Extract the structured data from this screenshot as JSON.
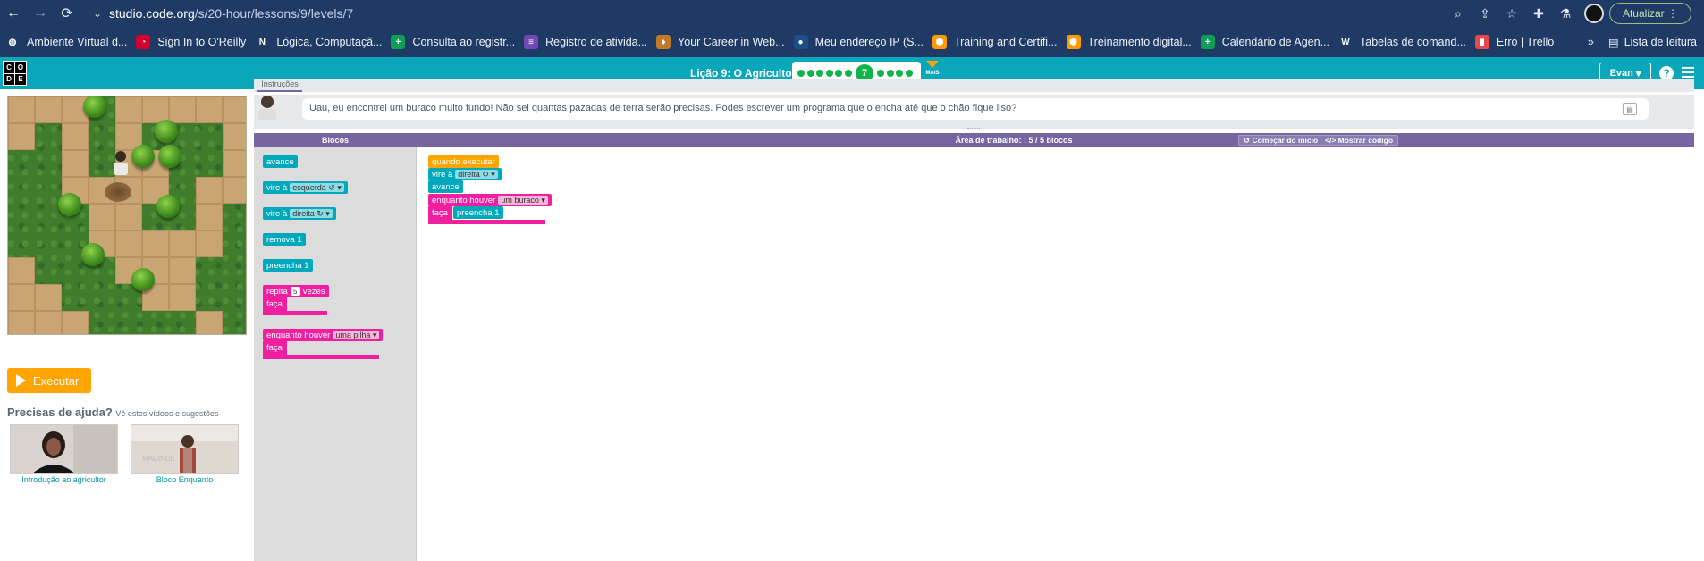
{
  "browser": {
    "url_host": "studio.code.org",
    "url_path": "/s/20-hour/lessons/9/levels/7",
    "update_label": "Atualizar",
    "bookmarks": [
      {
        "label": "Ambiente Virtual d...",
        "icon": "globe-icon",
        "color": "#ffffff"
      },
      {
        "label": "Sign In to O'Reilly",
        "icon": "oreilly-icon",
        "color": "#d3002d"
      },
      {
        "label": "Lógica, Computaçã...",
        "icon": "notion-icon",
        "color": "#ffffff"
      },
      {
        "label": "Consulta ao registr...",
        "icon": "sheets-icon",
        "color": "#0f9d58"
      },
      {
        "label": "Registro de ativida...",
        "icon": "forms-icon",
        "color": "#7248b9"
      },
      {
        "label": "Your Career in Web...",
        "icon": "badge-icon",
        "color": "#c0792a"
      },
      {
        "label": "Meu endereço IP (S...",
        "icon": "ip-icon",
        "color": "#1b4f8a"
      },
      {
        "label": "Training and Certifi...",
        "icon": "aws-icon",
        "color": "#ff9900"
      },
      {
        "label": "Treinamento digital...",
        "icon": "aws-icon",
        "color": "#ff9900"
      },
      {
        "label": "Calendário de Agen...",
        "icon": "sheets-icon",
        "color": "#0f9d58"
      },
      {
        "label": "Tabelas de comand...",
        "icon": "wordpress-icon",
        "color": "#ffffff"
      },
      {
        "label": "Erro | Trello",
        "icon": "trello-icon",
        "color": "#e5484d"
      }
    ],
    "reading_list_label": "Lista de leitura"
  },
  "header": {
    "lesson_title": "Lição 9: O Agricultor",
    "current_level": "7",
    "dots_before": 6,
    "dots_after": 4,
    "more_label": "MAIS",
    "user_label": "Evan"
  },
  "left": {
    "run_label": "Executar",
    "help_title": "Precisas de ajuda?",
    "help_sub": "Vê estes vídeos e sugestões",
    "videos": [
      {
        "caption": "Introdução ao agricultor"
      },
      {
        "caption": "Bloco Enquanto"
      }
    ]
  },
  "instructions": {
    "tab_label": "Instruções",
    "text": "Uau, eu encontrei um buraco muito fundo! Não sei quantas pazadas de terra serão precisas. Podes escrever um programa que o encha até que o chão fique liso?"
  },
  "workspace": {
    "blocks_title": "Blocos",
    "area_title": "Área de trabalho: : 5 / 5 blocos",
    "restart_label": "Começar do início",
    "show_code_label": "Mostrar código"
  },
  "toolbox": {
    "forward": "avance",
    "turn_label": "vire à",
    "turn_left": "esquerda ↺",
    "turn_right": "direita ↻",
    "remove": "remova 1",
    "fill": "preencha 1",
    "repeat_label": "repita",
    "repeat_count": "5",
    "repeat_times": "vezes",
    "do_label": "faça",
    "while_label": "enquanto houver",
    "while_option": "uma pilha"
  },
  "program": {
    "when_run": "quando executar",
    "turn_label": "vire à",
    "turn_dir": "direita ↻",
    "forward": "avance",
    "while_label": "enquanto houver",
    "while_option": "um buraco",
    "do_label": "faça",
    "fill": "preencha 1"
  }
}
